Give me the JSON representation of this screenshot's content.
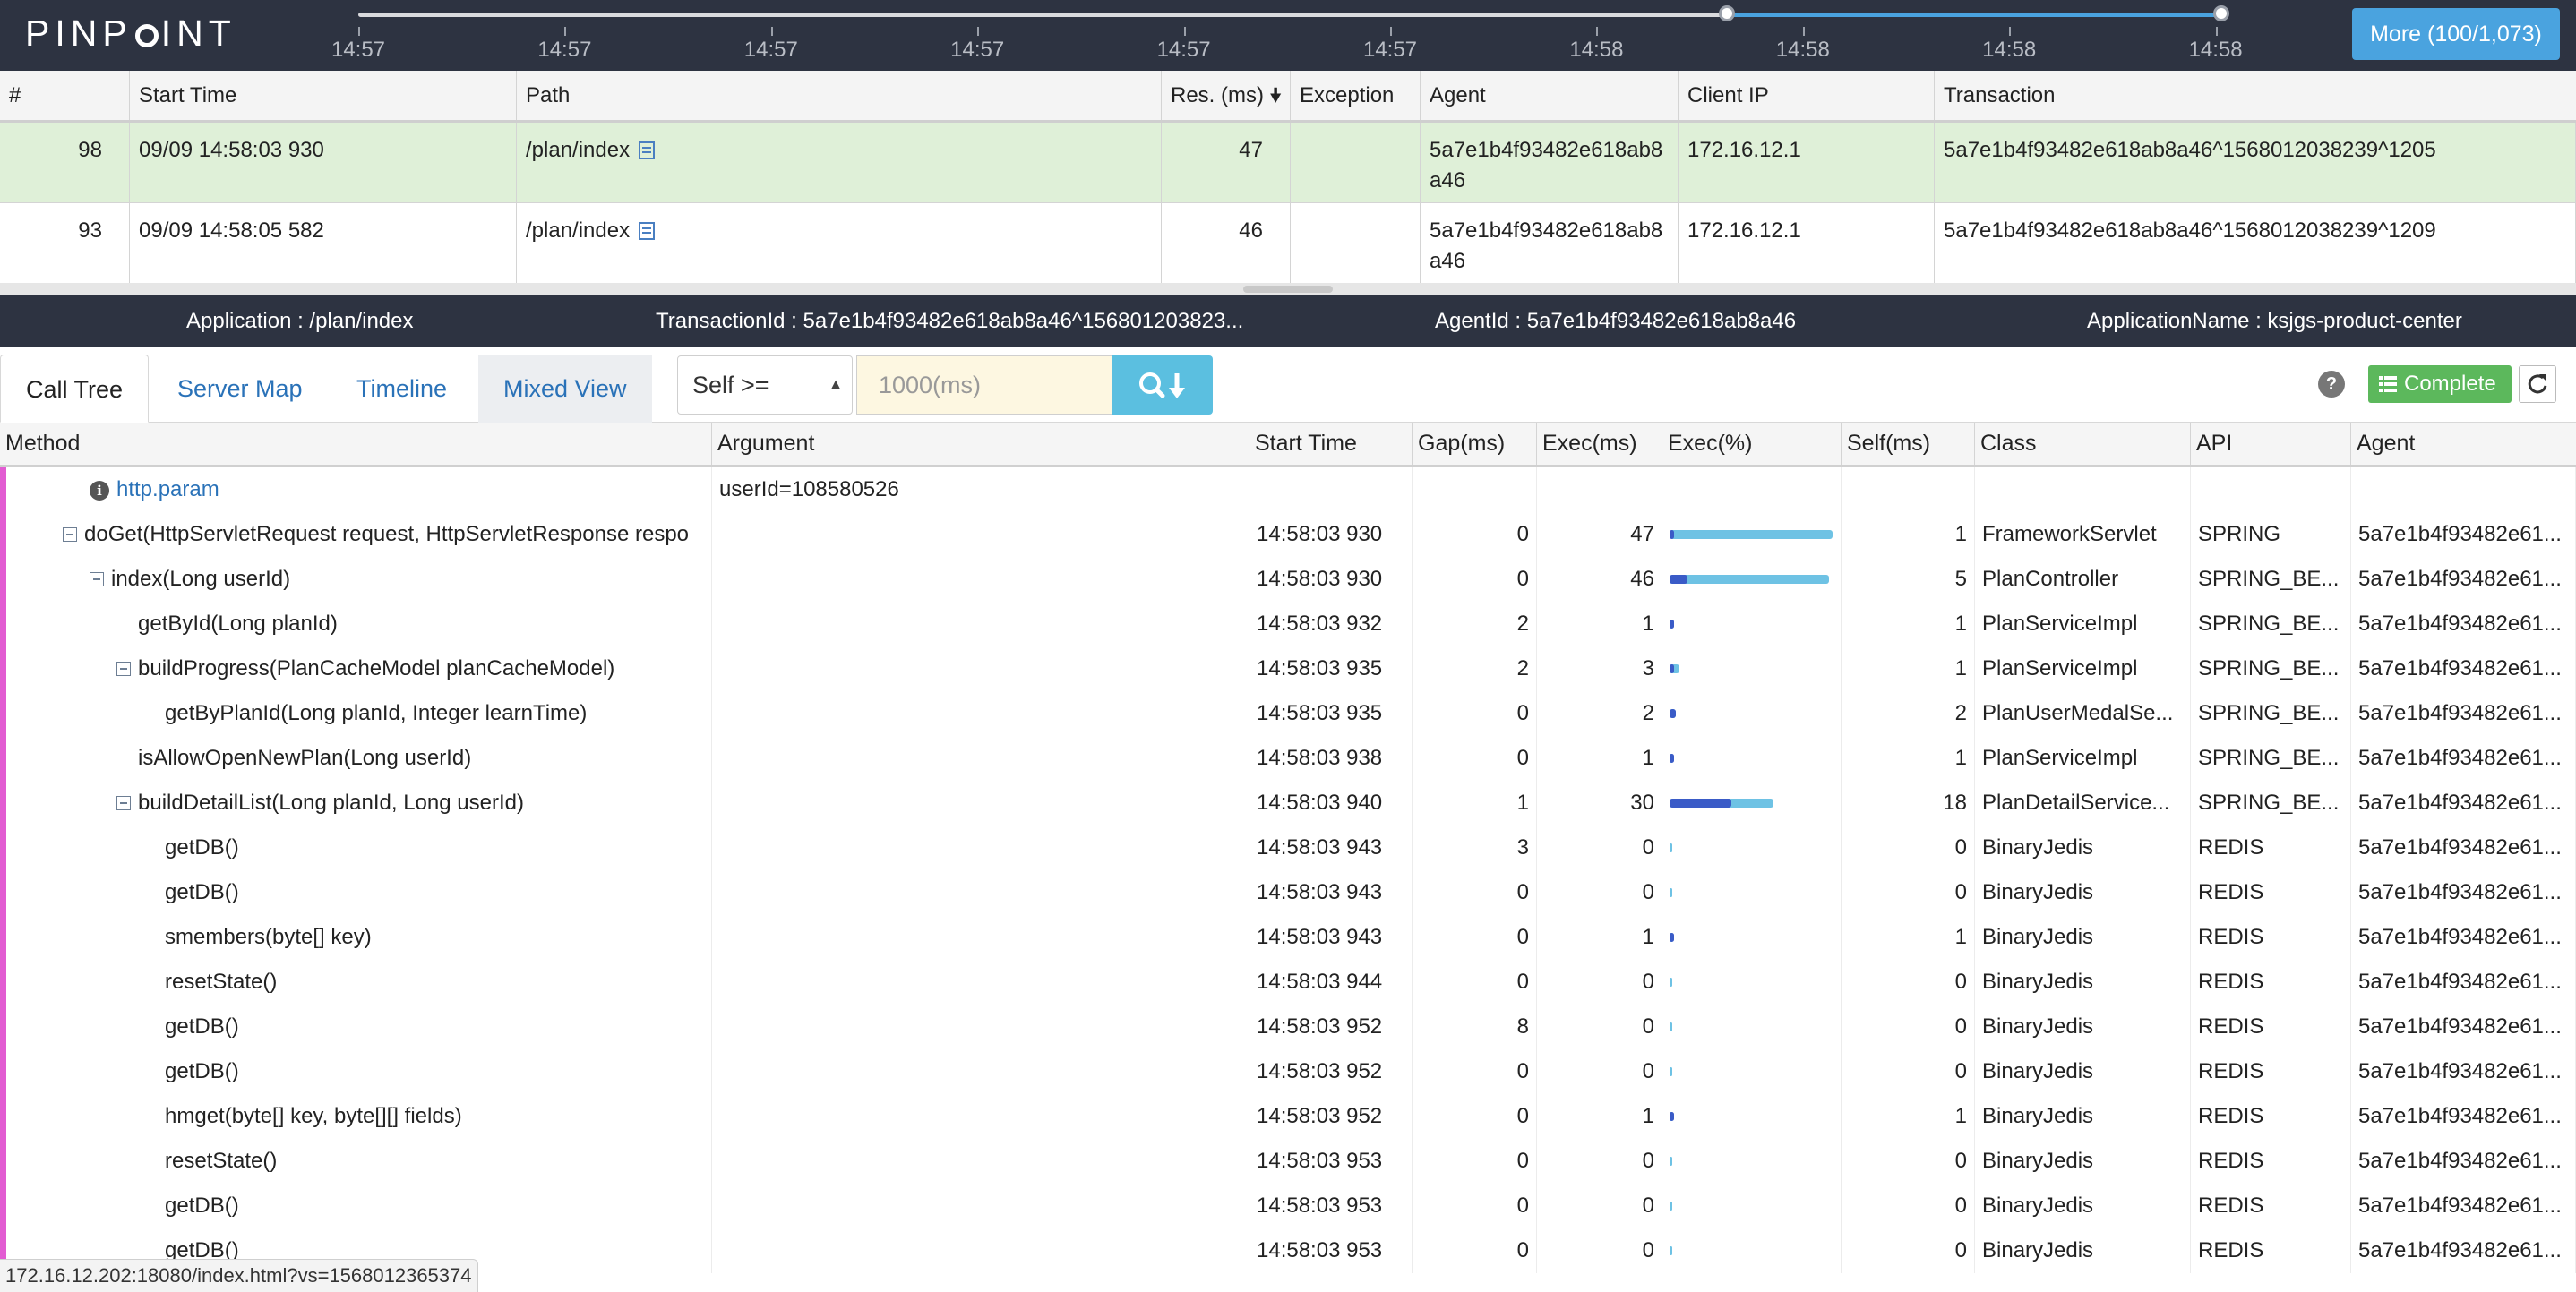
{
  "app": {
    "logo": "PINPOINT"
  },
  "timeline": {
    "labels": [
      "14:57",
      "14:57",
      "14:57",
      "14:57",
      "14:57",
      "14:57",
      "14:58",
      "14:58",
      "14:58",
      "14:58"
    ]
  },
  "more_button": "More (100/1,073)",
  "transactions": {
    "headers": [
      "#",
      "Start Time",
      "Path",
      "Res. (ms)",
      "Exception",
      "Agent",
      "Client IP",
      "Transaction"
    ],
    "rows": [
      {
        "num": "98",
        "start": "09/09 14:58:03 930",
        "path": "/plan/index",
        "res": "47",
        "exception": "",
        "agent": "5a7e1b4f93482e618ab8a46",
        "ip": "172.16.12.1",
        "tx": "5a7e1b4f93482e618ab8a46^1568012038239^1205",
        "selected": true
      },
      {
        "num": "93",
        "start": "09/09 14:58:05 582",
        "path": "/plan/index",
        "res": "46",
        "exception": "",
        "agent": "5a7e1b4f93482e618ab8a46",
        "ip": "172.16.12.1",
        "tx": "5a7e1b4f93482e618ab8a46^1568012038239^1209",
        "selected": false
      }
    ]
  },
  "infobar": {
    "application": "Application : /plan/index",
    "transaction_id": "TransactionId : 5a7e1b4f93482e618ab8a46^156801203823...",
    "agent_id": "AgentId : 5a7e1b4f93482e618ab8a46",
    "application_name": "ApplicationName : ksjgs-product-center"
  },
  "tabs": {
    "call_tree": "Call Tree",
    "server_map": "Server Map",
    "timeline": "Timeline",
    "mixed_view": "Mixed View"
  },
  "filter": {
    "select_value": "Self >=",
    "ms_placeholder": "1000(ms)",
    "complete_label": "Complete",
    "help": "?"
  },
  "grid": {
    "headers": [
      "Method",
      "Argument",
      "Start Time",
      "Gap(ms)",
      "Exec(ms)",
      "Exec(%)",
      "Self(ms)",
      "Class",
      "API",
      "Agent"
    ],
    "rows": [
      {
        "method": "http.param",
        "type": "param",
        "indent": 0,
        "argument": "userId=108580526",
        "start": "",
        "gap": "",
        "exec": "",
        "pct": null,
        "self_pct": null,
        "self": "",
        "cls": "",
        "api": "",
        "agent": ""
      },
      {
        "method": "doGet(HttpServletRequest request, HttpServletResponse respo",
        "type": "node",
        "indent": 0,
        "argument": "",
        "start": "14:58:03 930",
        "gap": "0",
        "exec": "47",
        "pct": 100,
        "self_pct": 2,
        "self": "1",
        "cls": "FrameworkServlet",
        "api": "SPRING",
        "agent": "5a7e1b4f93482e61..."
      },
      {
        "method": "index(Long userId)",
        "type": "node",
        "indent": 1,
        "argument": "",
        "start": "14:58:03 930",
        "gap": "0",
        "exec": "46",
        "pct": 98,
        "self_pct": 11,
        "self": "5",
        "cls": "PlanController",
        "api": "SPRING_BE...",
        "agent": "5a7e1b4f93482e61..."
      },
      {
        "method": "getById(Long planId)",
        "type": "leaf",
        "indent": 2,
        "argument": "",
        "start": "14:58:03 932",
        "gap": "2",
        "exec": "1",
        "pct": 2,
        "self_pct": 2,
        "self": "1",
        "cls": "PlanServiceImpl",
        "api": "SPRING_BE...",
        "agent": "5a7e1b4f93482e61..."
      },
      {
        "method": "buildProgress(PlanCacheModel planCacheModel)",
        "type": "node",
        "indent": 2,
        "argument": "",
        "start": "14:58:03 935",
        "gap": "2",
        "exec": "3",
        "pct": 6,
        "self_pct": 2,
        "self": "1",
        "cls": "PlanServiceImpl",
        "api": "SPRING_BE...",
        "agent": "5a7e1b4f93482e61..."
      },
      {
        "method": "getByPlanId(Long planId, Integer learnTime)",
        "type": "leaf",
        "indent": 3,
        "argument": "",
        "start": "14:58:03 935",
        "gap": "0",
        "exec": "2",
        "pct": 4,
        "self_pct": 4,
        "self": "2",
        "cls": "PlanUserMedalSe...",
        "api": "SPRING_BE...",
        "agent": "5a7e1b4f93482e61..."
      },
      {
        "method": "isAllowOpenNewPlan(Long userId)",
        "type": "leaf",
        "indent": 2,
        "argument": "",
        "start": "14:58:03 938",
        "gap": "0",
        "exec": "1",
        "pct": 2,
        "self_pct": 2,
        "self": "1",
        "cls": "PlanServiceImpl",
        "api": "SPRING_BE...",
        "agent": "5a7e1b4f93482e61..."
      },
      {
        "method": "buildDetailList(Long planId, Long userId)",
        "type": "node",
        "indent": 2,
        "argument": "",
        "start": "14:58:03 940",
        "gap": "1",
        "exec": "30",
        "pct": 64,
        "self_pct": 38,
        "self": "18",
        "cls": "PlanDetailService...",
        "api": "SPRING_BE...",
        "agent": "5a7e1b4f93482e61..."
      },
      {
        "method": "getDB()",
        "type": "leaf",
        "indent": 3,
        "argument": "",
        "start": "14:58:03 943",
        "gap": "3",
        "exec": "0",
        "pct": 0,
        "self_pct": 0,
        "self": "0",
        "cls": "BinaryJedis",
        "api": "REDIS",
        "agent": "5a7e1b4f93482e61..."
      },
      {
        "method": "getDB()",
        "type": "leaf",
        "indent": 3,
        "argument": "",
        "start": "14:58:03 943",
        "gap": "0",
        "exec": "0",
        "pct": 0,
        "self_pct": 0,
        "self": "0",
        "cls": "BinaryJedis",
        "api": "REDIS",
        "agent": "5a7e1b4f93482e61..."
      },
      {
        "method": "smembers(byte[] key)",
        "type": "leaf",
        "indent": 3,
        "argument": "",
        "start": "14:58:03 943",
        "gap": "0",
        "exec": "1",
        "pct": 2,
        "self_pct": 2,
        "self": "1",
        "cls": "BinaryJedis",
        "api": "REDIS",
        "agent": "5a7e1b4f93482e61..."
      },
      {
        "method": "resetState()",
        "type": "leaf",
        "indent": 3,
        "argument": "",
        "start": "14:58:03 944",
        "gap": "0",
        "exec": "0",
        "pct": 0,
        "self_pct": 0,
        "self": "0",
        "cls": "BinaryJedis",
        "api": "REDIS",
        "agent": "5a7e1b4f93482e61..."
      },
      {
        "method": "getDB()",
        "type": "leaf",
        "indent": 3,
        "argument": "",
        "start": "14:58:03 952",
        "gap": "8",
        "exec": "0",
        "pct": 0,
        "self_pct": 0,
        "self": "0",
        "cls": "BinaryJedis",
        "api": "REDIS",
        "agent": "5a7e1b4f93482e61..."
      },
      {
        "method": "getDB()",
        "type": "leaf",
        "indent": 3,
        "argument": "",
        "start": "14:58:03 952",
        "gap": "0",
        "exec": "0",
        "pct": 0,
        "self_pct": 0,
        "self": "0",
        "cls": "BinaryJedis",
        "api": "REDIS",
        "agent": "5a7e1b4f93482e61..."
      },
      {
        "method": "hmget(byte[] key, byte[][] fields)",
        "type": "leaf",
        "indent": 3,
        "argument": "",
        "start": "14:58:03 952",
        "gap": "0",
        "exec": "1",
        "pct": 2,
        "self_pct": 2,
        "self": "1",
        "cls": "BinaryJedis",
        "api": "REDIS",
        "agent": "5a7e1b4f93482e61..."
      },
      {
        "method": "resetState()",
        "type": "leaf",
        "indent": 3,
        "argument": "",
        "start": "14:58:03 953",
        "gap": "0",
        "exec": "0",
        "pct": 0,
        "self_pct": 0,
        "self": "0",
        "cls": "BinaryJedis",
        "api": "REDIS",
        "agent": "5a7e1b4f93482e61..."
      },
      {
        "method": "getDB()",
        "type": "leaf",
        "indent": 3,
        "argument": "",
        "start": "14:58:03 953",
        "gap": "0",
        "exec": "0",
        "pct": 0,
        "self_pct": 0,
        "self": "0",
        "cls": "BinaryJedis",
        "api": "REDIS",
        "agent": "5a7e1b4f93482e61..."
      },
      {
        "method": "getDB()",
        "type": "leaf",
        "indent": 3,
        "argument": "",
        "start": "14:58:03 953",
        "gap": "0",
        "exec": "0",
        "pct": 0,
        "self_pct": 0,
        "self": "0",
        "cls": "BinaryJedis",
        "api": "REDIS",
        "agent": "5a7e1b4f93482e61..."
      }
    ]
  },
  "status_url": "172.16.12.202:18080/index.html?vs=1568012365374",
  "colors": {
    "topbar": "#2d3341",
    "accent": "#4aa3df",
    "selected_row": "#dff0d8",
    "pink_bar": "#e25cd2",
    "complete": "#5cb85c"
  }
}
